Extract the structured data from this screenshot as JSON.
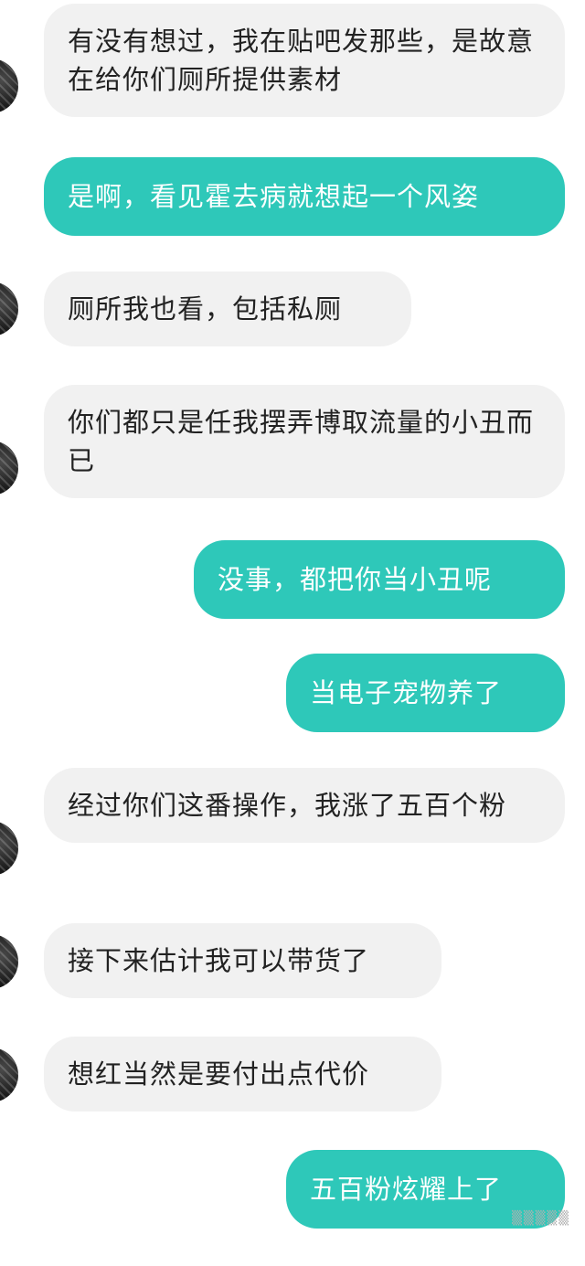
{
  "messages": [
    {
      "side": "in",
      "text": "有没有想过，我在贴吧发那些，是故意在给你们厕所提供素材"
    },
    {
      "side": "out",
      "text": "是啊，看见霍去病就想起一个风姿"
    },
    {
      "side": "in",
      "text": "厕所我也看，包括私厕"
    },
    {
      "side": "in",
      "text": "你们都只是任我摆弄博取流量的小丑而已"
    },
    {
      "side": "out",
      "text": "没事，都把你当小丑呢"
    },
    {
      "side": "out",
      "text": "当电子宠物养了"
    },
    {
      "side": "in",
      "text": "经过你们这番操作，我涨了五百个粉"
    },
    {
      "side": "in",
      "text": "接下来估计我可以带货了"
    },
    {
      "side": "in",
      "text": "想红当然是要付出点代价"
    },
    {
      "side": "out",
      "text": "五百粉炫耀上了"
    }
  ],
  "watermark": "▒▒▒▒▒",
  "colors": {
    "incoming_bubble": "#f1f1f1",
    "outgoing_bubble": "#2ec8b9",
    "incoming_text": "#222222",
    "outgoing_text": "#ffffff"
  }
}
